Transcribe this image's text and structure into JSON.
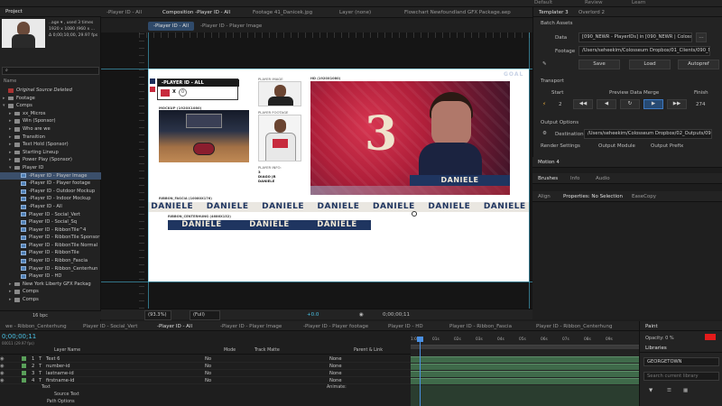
{
  "top_tabs": [
    "Default",
    "Review",
    "Learn"
  ],
  "project": {
    "panel_title": "Project",
    "thumb_line1": "..age ▾ , used 3 times",
    "thumb_line2": "1920 x 1080 (960 x ...",
    "thumb_line3": "Δ 0;00;10;00, 29.97 fps",
    "search_placeholder": "⌕",
    "column_name": "Name",
    "bpc_label": "16 bpc",
    "tree": [
      {
        "label": "Original Source Deleted",
        "type": "missing",
        "indent": 0
      },
      {
        "label": "Footage",
        "type": "folder",
        "indent": 0,
        "tri": ">"
      },
      {
        "label": "Comps",
        "type": "folder",
        "indent": 0,
        "tri": "v"
      },
      {
        "label": "xx_Micros",
        "type": "folder",
        "indent": 1,
        "tri": ">"
      },
      {
        "label": "Win (Sponsor)",
        "type": "folder",
        "indent": 1,
        "tri": ">"
      },
      {
        "label": "Who are we",
        "type": "folder",
        "indent": 1,
        "tri": ">"
      },
      {
        "label": "Transition",
        "type": "folder",
        "indent": 1,
        "tri": ">"
      },
      {
        "label": "Text Hold (Sponsor)",
        "type": "folder",
        "indent": 1,
        "tri": ">"
      },
      {
        "label": "Starting Lineup",
        "type": "folder",
        "indent": 1,
        "tri": ">"
      },
      {
        "label": "Power Play (Sponsor)",
        "type": "folder",
        "indent": 1,
        "tri": ">"
      },
      {
        "label": "Player ID",
        "type": "folder",
        "indent": 1,
        "tri": "v"
      },
      {
        "label": "-Player ID - Player Image",
        "type": "comp",
        "indent": 2,
        "selected": true
      },
      {
        "label": "-Player ID - Player footage",
        "type": "comp",
        "indent": 2
      },
      {
        "label": "-Player ID - Outdoor Mockup",
        "type": "comp",
        "indent": 2
      },
      {
        "label": "-Player ID - Indoor Mockup",
        "type": "comp",
        "indent": 2
      },
      {
        "label": "-Player ID - All",
        "type": "comp",
        "indent": 2
      },
      {
        "label": "Player ID - Social_Vert",
        "type": "comp",
        "indent": 2
      },
      {
        "label": "Player ID - Social_Sq",
        "type": "comp",
        "indent": 2
      },
      {
        "label": "Player ID - RibbonTile^4",
        "type": "comp",
        "indent": 2
      },
      {
        "label": "Player ID - RibbonTile Sponsor",
        "type": "comp",
        "indent": 2
      },
      {
        "label": "Player ID - RibbonTile Normal",
        "type": "comp",
        "indent": 2
      },
      {
        "label": "Player ID - RibbonTile",
        "type": "comp",
        "indent": 2
      },
      {
        "label": "Player ID - Ribbon_Fascia",
        "type": "comp",
        "indent": 2
      },
      {
        "label": "Player ID - Ribbon_Centerhun",
        "type": "comp",
        "indent": 2
      },
      {
        "label": "Player ID - HD",
        "type": "comp",
        "indent": 2
      },
      {
        "label": "New York Liberty GFX Packag",
        "type": "folder",
        "indent": 1,
        "tri": ">"
      },
      {
        "label": "Comps",
        "type": "folder",
        "indent": 1,
        "tri": ">"
      },
      {
        "label": "Comps",
        "type": "folder",
        "indent": 1,
        "tri": ">"
      }
    ]
  },
  "comp_tabs": {
    "left_tab": "-Player ID - All",
    "composition_tab": "Composition -Player ID - All",
    "footage_tab": "Footage 41_Danicek.jpg",
    "layer_tab": "Layer (none)",
    "flowchart_tab": "Flowchart Newfoundland GFX Package.aep",
    "breadcrumb_1": "-Player ID - All",
    "breadcrumb_2": "-Player ID - Player Image"
  },
  "artboard": {
    "player_id_label": "-PLAYER ID - ALL",
    "x_label": "X",
    "vs_label": "0",
    "player_image_label": "PLAYER IMAGE",
    "player_footage_label": "PLAYER FOOTAGE",
    "hd_label": "HD (1920X1080)",
    "mockup_label": "MOCKUP (1920X1080)",
    "player_info_label": "PLAYER INFO:",
    "player_info_lines": [
      "3",
      "DIAGO JR",
      "DANIELE"
    ],
    "goal_text": "GOAL",
    "jersey_number": "3",
    "name_plate": "DANIELE",
    "fascia_label": "RIBBON_FASCIA (10080X176)",
    "fascia_names": [
      "DANIELE",
      "DANIELE",
      "DANIELE",
      "DANIELE",
      "DANIELE",
      "DANIELE",
      "DANIELE"
    ],
    "centerhung_label": "RIBBON_CENTERHUNG (4686X152)",
    "centerhung_names": [
      "DANIELE",
      "DANIELE",
      "DANIELE"
    ]
  },
  "viewer_footer": {
    "zoom": "(93.3%)",
    "resolution": "(Full)",
    "exposure": "+0.0",
    "timecode": "0;00;00;11"
  },
  "templater": {
    "tab_main": "Templater 3",
    "tab_other": "Overlord 2",
    "batch_assets": "Batch Assets",
    "data_label": "Data",
    "data_value": "[090_NEWR - PlayerIDs] in [090_NEWR | Colosseu",
    "footage_label": "Footage",
    "footage_value": "/Users/seheekim/Colosseum Dropbox/01_Clients/090_NEWR/Foota",
    "save_btn": "Save",
    "load_btn": "Load",
    "autopref_btn": "Autopref",
    "transport_label": "Transport",
    "start_label": "Start",
    "start_value": "2",
    "preview_label": "Preview Data Merge",
    "finish_label": "Finish",
    "finish_value": "274",
    "output_options": "Output Options",
    "destination_label": "Destination",
    "destination_value": "/Users/seheekim/Colosseum Dropbox/02_Outputs/090_GTN",
    "render_settings": "Render Settings",
    "output_module": "Output Module",
    "output_prefix": "Output Prefix"
  },
  "motion_panel": {
    "title": "Motion 4"
  },
  "brushes_tabs": [
    "Brushes",
    "Info",
    "Audio"
  ],
  "align_tabs": [
    "Align",
    "Properties: No Selection",
    "EaseCopy"
  ],
  "timeline": {
    "tabs": [
      "we - Ribbon_Centerhung",
      "Player ID - Social_Vert",
      "-Player ID - All",
      "-Player ID - Player Image",
      "-Player ID - Player footage",
      "Player ID - HD",
      "Player ID - Ribbon_Fascia",
      "Player ID - Ribbon_Centerhung"
    ],
    "timecode": "0;00;00;11",
    "timecode_sub": "00011 (29.97 fps)",
    "columns": {
      "layer_name": "Layer Name",
      "mode": "Mode",
      "trackmatte": "Track Matte",
      "parent": "Parent & Link"
    },
    "layers": [
      {
        "num": "1",
        "name": "Text 6",
        "mode": "No",
        "parent": "None"
      },
      {
        "num": "2",
        "name": "number-id",
        "mode": "No",
        "parent": "None"
      },
      {
        "num": "3",
        "name": "lastname-id",
        "mode": "No",
        "parent": "None"
      },
      {
        "num": "4",
        "name": "firstname-id",
        "mode": "No",
        "parent": "None"
      }
    ],
    "sub_text": "Text",
    "sub_source": "Source Text",
    "sub_path": "Path Options",
    "animate_label": "Animate:",
    "ruler": [
      "1:00f",
      "01s",
      "02s",
      "03s",
      "04s",
      "05s",
      "06s",
      "07s",
      "08s",
      "09s"
    ]
  },
  "paint": {
    "title": "Paint",
    "opacity": "Opacity: 0 %"
  },
  "libraries": {
    "title": "Libraries",
    "library_name": "GEORGETOWN",
    "search_placeholder": "Search current library"
  }
}
